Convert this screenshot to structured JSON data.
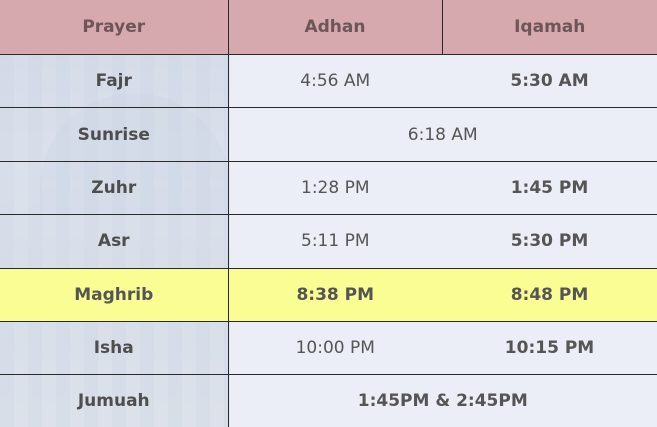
{
  "header": {
    "prayer": "Prayer",
    "adhan": "Adhan",
    "iqamah": "Iqamah"
  },
  "rows": [
    {
      "name": "Fajr",
      "adhan": "4:56 AM",
      "iqamah": "5:30 AM"
    },
    {
      "name": "Sunrise",
      "time": "6:18 AM"
    },
    {
      "name": "Zuhr",
      "adhan": "1:28 PM",
      "iqamah": "1:45 PM"
    },
    {
      "name": "Asr",
      "adhan": "5:11 PM",
      "iqamah": "5:30 PM"
    },
    {
      "name": "Maghrib",
      "adhan": "8:38 PM",
      "iqamah": "8:48 PM"
    },
    {
      "name": "Isha",
      "adhan": "10:00 PM",
      "iqamah": "10:15 PM"
    },
    {
      "name": "Jumuah",
      "time": "1:45PM & 2:45PM"
    }
  ],
  "colors": {
    "header_bg": "#d5a9ae",
    "highlight": "#f9fd93"
  }
}
